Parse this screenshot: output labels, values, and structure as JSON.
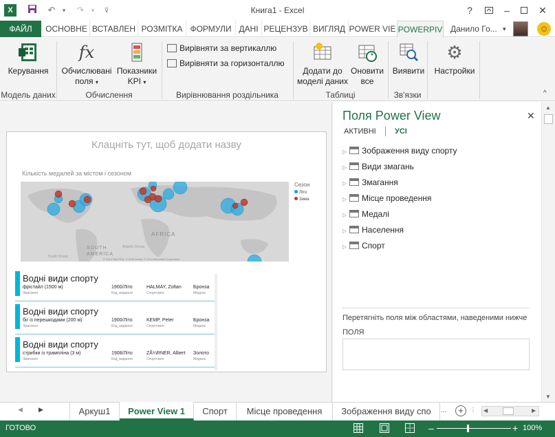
{
  "window": {
    "title": "Книга1 - Excel"
  },
  "tabs": {
    "file": "ФАЙЛ",
    "items": [
      "ОСНОВНЕ",
      "ВСТАВЛЕН",
      "РОЗМІТКА",
      "ФОРМУЛИ",
      "ДАНІ",
      "РЕЦЕНЗУВ",
      "ВИГЛЯД",
      "POWER VIE",
      "POWERPIV"
    ],
    "active_index": 8
  },
  "user": {
    "name": "Данило Го..."
  },
  "ribbon": {
    "manage": "Керування",
    "calc_fields": [
      "Обчислювані",
      "поля"
    ],
    "kpi": [
      "Показники",
      "KPI"
    ],
    "align_vertical": "Вирівняти за вертикаллю",
    "align_horizontal": "Вирівняти за горизонталлю",
    "add_to_model": [
      "Додати до",
      "моделі даних"
    ],
    "refresh_all": [
      "Оновити",
      "все"
    ],
    "detect": "Виявити",
    "settings": "Настройки",
    "groups": [
      "Модель даних",
      "Обчислення",
      "Вирівнювання роздільника",
      "Таблиці",
      "Зв'язки"
    ]
  },
  "report": {
    "title_placeholder": "Клацніть тут, щоб додати назву",
    "map_caption": "Кількість медалей за містом і сезоном",
    "legend_title": "Сезон",
    "legend": [
      {
        "label": "Літо",
        "color": "#00a8e0"
      },
      {
        "label": "Зима",
        "color": "#c0392b"
      }
    ],
    "map_labels": [
      "AFRICA",
      "SOUTH AMERICA",
      "Atlantic Ocean",
      "South Ocean"
    ],
    "map_copyright": "© 2014 NAVTEQ, © 2016 Nokia, © 2014 Microsoft Corporation",
    "tiles": [
      {
        "header": "Водні види спорту",
        "cells": [
          "фрістайл (1500 м)",
          "1900/Літо",
          "HALMAY, Zoltan",
          "Бронза"
        ],
        "labels": [
          "Змагання",
          "Код_видання",
          "Спортсмен",
          "Медаль"
        ]
      },
      {
        "header": "Водні види спорту",
        "cells": [
          "біг із перешкодами (200 м)",
          "1900/Літо",
          "KEMP, Peter",
          "Бронза"
        ],
        "labels": [
          "Змагання",
          "Код_видання",
          "Спортсмен",
          "Медаль"
        ]
      },
      {
        "header": "Водні види спорту",
        "cells": [
          "стрибки із трампліна (3 м)",
          "1908/Літо",
          "ZÃ¼RNER, Albert",
          "Золото"
        ],
        "labels": [
          "Змагання",
          "Код_видання",
          "Спортсмен",
          "Медаль"
        ]
      }
    ]
  },
  "fields_pane": {
    "title": "Поля Power View",
    "tabs": [
      "АКТИВНІ",
      "УСІ"
    ],
    "items": [
      "Зображення виду спорту",
      "Види змагань",
      "Змагання",
      "Місце проведення",
      "Медалі",
      "Населення",
      "Спорт"
    ],
    "drag_hint": "Перетягніть поля між областями, наведеними нижче",
    "fields_label": "ПОЛЯ"
  },
  "sheets": {
    "items": [
      "Аркуш1",
      "Power View 1",
      "Спорт",
      "Місце проведення",
      "Зображення виду спо"
    ],
    "active_index": 1
  },
  "status": {
    "ready": "ГОТОВО",
    "zoom": "100%"
  },
  "colors": {
    "accent": "#217346",
    "tile_bar": "#00b6d6"
  }
}
